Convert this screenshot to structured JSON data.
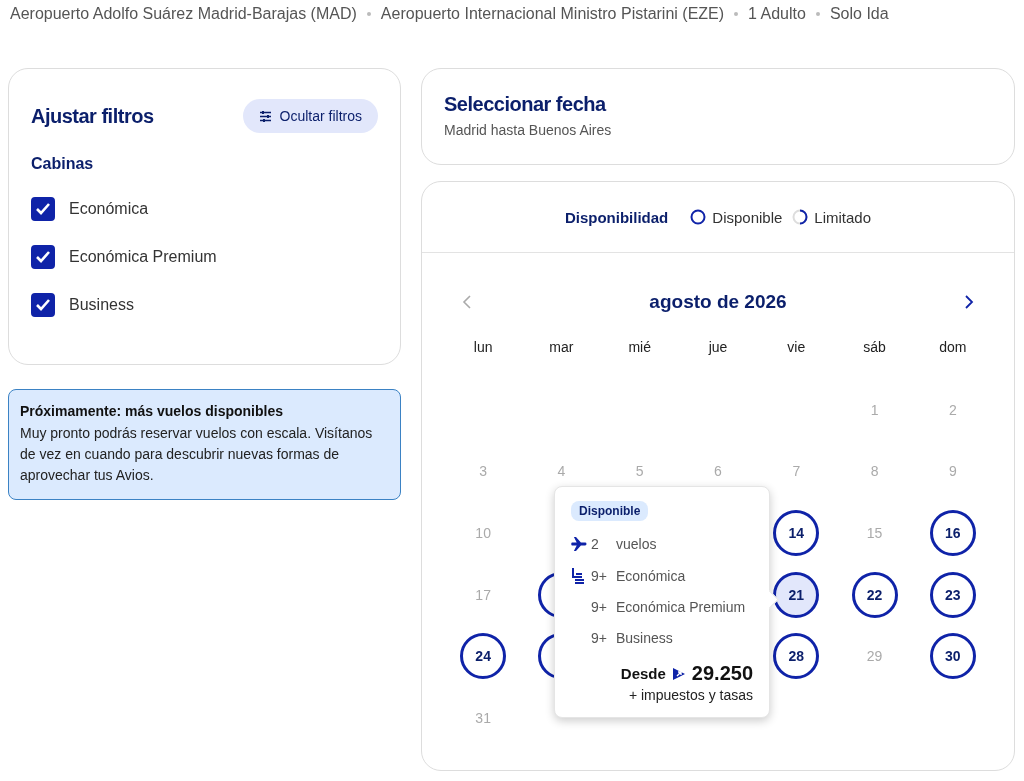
{
  "breadcrumb": [
    "Aeropuerto Adolfo Suárez Madrid-Barajas (MAD)",
    "Aeropuerto Internacional Ministro Pistarini (EZE)",
    "1 Adulto",
    "Solo Ida"
  ],
  "filters": {
    "title": "Ajustar filtros",
    "toggle_button": "Ocultar filtros",
    "section": "Cabinas",
    "cabins": [
      {
        "label": "Económica",
        "checked": true
      },
      {
        "label": "Económica Premium",
        "checked": true
      },
      {
        "label": "Business",
        "checked": true
      }
    ]
  },
  "notice": {
    "title": "Próximamente: más vuelos disponibles",
    "body": "Muy pronto podrás reservar vuelos con escala. Visítanos de vez en cuando para descubrir nuevas formas de aprovechar tus Avios."
  },
  "date_card": {
    "title": "Seleccionar fecha",
    "subtitle": "Madrid hasta Buenos Aires"
  },
  "legend": {
    "title": "Disponibilidad",
    "items": [
      {
        "kind": "full",
        "label": "Disponible"
      },
      {
        "kind": "partial",
        "label": "Limitado"
      }
    ]
  },
  "calendar": {
    "month": "agosto de 2026",
    "weekdays": [
      "lun",
      "mar",
      "mié",
      "jue",
      "vie",
      "sáb",
      "dom"
    ],
    "weeks": [
      [
        {
          "kind": "blank"
        },
        {
          "kind": "blank"
        },
        {
          "kind": "blank"
        },
        {
          "kind": "blank"
        },
        {
          "kind": "blank"
        },
        {
          "kind": "unavailable",
          "day": "1",
          "selected": false
        },
        {
          "kind": "unavailable",
          "day": "2",
          "selected": false
        }
      ],
      [
        {
          "kind": "unavailable",
          "day": "3",
          "selected": false
        },
        {
          "kind": "unavailable",
          "day": "4",
          "selected": false
        },
        {
          "kind": "unavailable",
          "day": "5",
          "selected": false
        },
        {
          "kind": "unavailable",
          "day": "6",
          "selected": false
        },
        {
          "kind": "unavailable",
          "day": "7",
          "selected": false
        },
        {
          "kind": "unavailable",
          "day": "8",
          "selected": false
        },
        {
          "kind": "unavailable",
          "day": "9",
          "selected": false
        }
      ],
      [
        {
          "kind": "unavailable",
          "day": "10",
          "selected": false
        },
        {
          "kind": "blank"
        },
        {
          "kind": "blank"
        },
        {
          "kind": "blank"
        },
        {
          "kind": "available",
          "day": "14",
          "selected": false
        },
        {
          "kind": "unavailable",
          "day": "15",
          "selected": false
        },
        {
          "kind": "available",
          "day": "16",
          "selected": false
        }
      ],
      [
        {
          "kind": "unavailable",
          "day": "17",
          "selected": false
        },
        {
          "kind": "available",
          "selected": false
        },
        {
          "kind": "blank"
        },
        {
          "kind": "blank"
        },
        {
          "kind": "available",
          "day": "21",
          "selected": true
        },
        {
          "kind": "available",
          "day": "22",
          "selected": false
        },
        {
          "kind": "available",
          "day": "23",
          "selected": false
        }
      ],
      [
        {
          "kind": "available",
          "day": "24",
          "selected": false
        },
        {
          "kind": "available",
          "selected": false
        },
        {
          "kind": "blank"
        },
        {
          "kind": "blank"
        },
        {
          "kind": "available",
          "day": "28",
          "selected": false
        },
        {
          "kind": "unavailable",
          "day": "29",
          "selected": false
        },
        {
          "kind": "available",
          "day": "30",
          "selected": false
        }
      ],
      [
        {
          "kind": "unavailable",
          "day": "31",
          "selected": false
        }
      ]
    ]
  },
  "tooltip": {
    "badge": "Disponible",
    "rows": [
      {
        "kind": "plane",
        "count": "2",
        "label": "vuelos"
      },
      {
        "kind": "seat",
        "count": "9+",
        "label": "Económica"
      },
      {
        "kind": "plain",
        "count": "9+",
        "label": "Económica Premium"
      },
      {
        "kind": "plain",
        "count": "9+",
        "label": "Business"
      }
    ],
    "price_prefix": "Desde",
    "price": "29.250",
    "price_note": "+ impuestos y tasas"
  }
}
